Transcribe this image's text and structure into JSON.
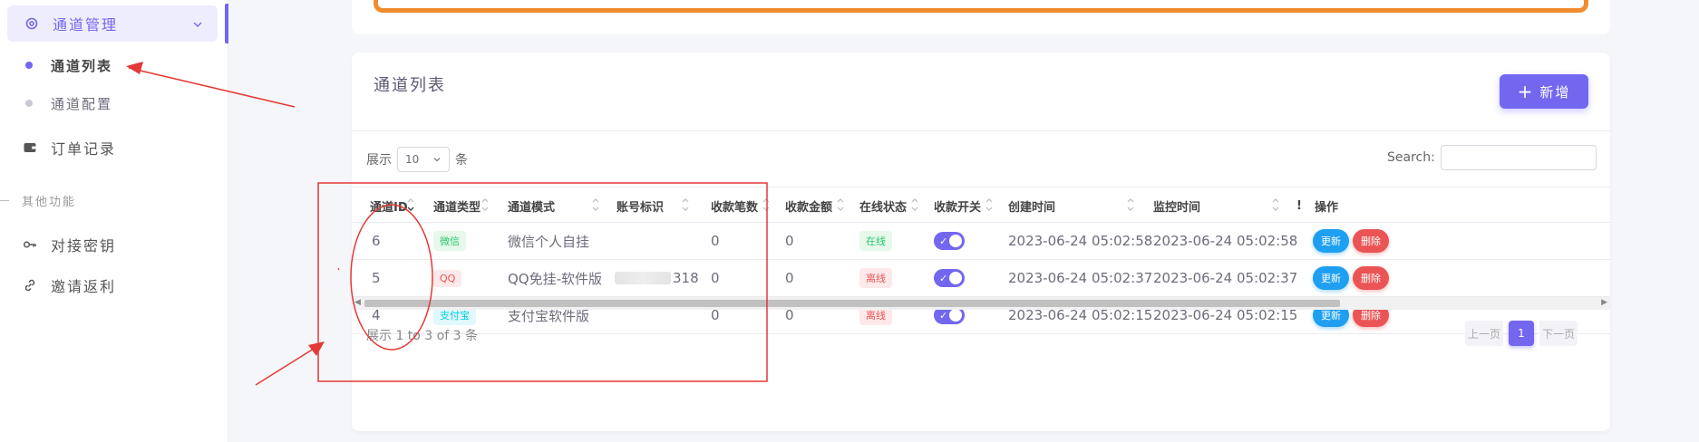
{
  "sidebar": {
    "group_label": "通道管理",
    "sub_items": [
      {
        "label": "通道列表",
        "active": true
      },
      {
        "label": "通道配置",
        "active": false
      }
    ],
    "order_label": "订单记录",
    "section_label": "其他功能",
    "api_key_label": "对接密钥",
    "invite_label": "邀请返利"
  },
  "card": {
    "title": "通道列表",
    "add_button": "新增",
    "show_prefix": "展示",
    "page_size": "10",
    "show_suffix": "条",
    "search_label": "Search:"
  },
  "table": {
    "headers": [
      "通道ID",
      "通道类型",
      "通道模式",
      "账号标识",
      "收款笔数",
      "收款金额",
      "在线状态",
      "收款开关",
      "创建时间",
      "监控时间",
      "!",
      "操作"
    ],
    "rows": [
      {
        "id": "6",
        "type": "微信",
        "mode": "微信个人自挂",
        "account": "",
        "count": "0",
        "amount": "0",
        "status": "在线",
        "created": "2023-06-24 05:02:58",
        "monitored": "2023-06-24 05:02:58",
        "update": "更新",
        "delete": "删除"
      },
      {
        "id": "5",
        "type": "QQ",
        "mode": "QQ免挂-软件版",
        "account": "318",
        "count": "0",
        "amount": "0",
        "status": "离线",
        "created": "2023-06-24 05:02:37",
        "monitored": "2023-06-24 05:02:37",
        "update": "更新",
        "delete": "删除"
      },
      {
        "id": "4",
        "type": "支付宝",
        "mode": "支付宝软件版",
        "account": "",
        "count": "0",
        "amount": "0",
        "status": "离线",
        "created": "2023-06-24 05:02:15",
        "monitored": "2023-06-24 05:02:15",
        "update": "更新",
        "delete": "删除"
      }
    ]
  },
  "footer": {
    "info": "展示 1 to 3 of 3 条",
    "prev": "上一页",
    "current": "1",
    "next": "下一页"
  },
  "colors": {
    "accent": "#7367f0",
    "annotation": "#e53935",
    "orange_frame": "#f08c2e"
  }
}
